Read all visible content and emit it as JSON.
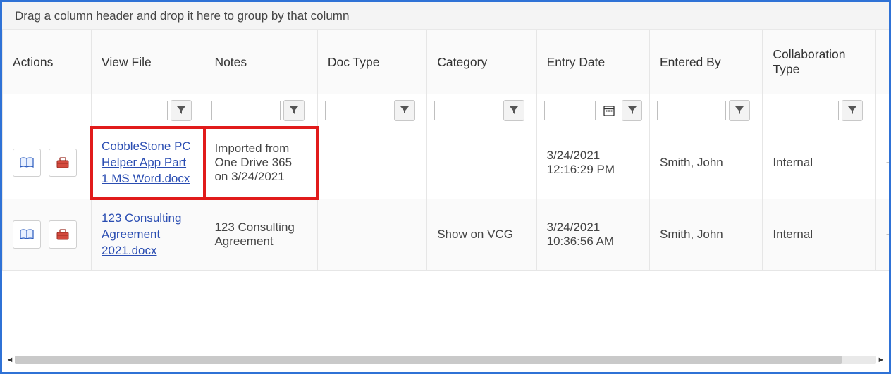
{
  "group_hint": "Drag a column header and drop it here to group by that column",
  "columns": {
    "actions": "Actions",
    "view_file": "View File",
    "notes": "Notes",
    "doc_type": "Doc Type",
    "category": "Category",
    "entry_date": "Entry Date",
    "entered_by": "Entered By",
    "collab_type": "Collaboration Type"
  },
  "icons": {
    "filter": "▼",
    "calendar": "📅",
    "book": "📖",
    "toolbox": "🧰",
    "left": "◄",
    "right": "►"
  },
  "rows": [
    {
      "file": "CobbleStone PC Helper App Part 1 MS Word.docx",
      "notes": "Imported from One Drive 365 on 3/24/2021",
      "doc_type": "",
      "category": "",
      "entry_date": "3/24/2021 12:16:29 PM",
      "entered_by": "Smith, John",
      "collab_type": "Internal"
    },
    {
      "file": "123 Consulting Agreement 2021.docx",
      "notes": "123 Consulting Agreement",
      "doc_type": "",
      "category": "Show on VCG",
      "entry_date": "3/24/2021 10:36:56 AM",
      "entered_by": "Smith, John",
      "collab_type": "Internal"
    }
  ]
}
